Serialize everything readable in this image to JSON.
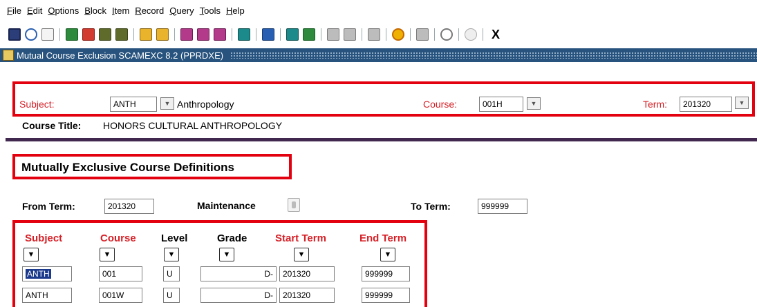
{
  "menu": [
    "File",
    "Edit",
    "Options",
    "Block",
    "Item",
    "Record",
    "Query",
    "Tools",
    "Help"
  ],
  "toolbar": {
    "exit_label": "X"
  },
  "window": {
    "title": "Mutual Course Exclusion  SCAMEXC  8.2  (PPRDXE)"
  },
  "key_block": {
    "subject_label": "Subject:",
    "subject_value": "ANTH",
    "subject_desc": "Anthropology",
    "course_label": "Course:",
    "course_value": "001H",
    "term_label": "Term:",
    "term_value": "201320",
    "course_title_label": "Course Title:",
    "course_title_value": "HONORS CULTURAL ANTHROPOLOGY"
  },
  "section": {
    "heading": "Mutually Exclusive Course Definitions",
    "from_term_label": "From Term:",
    "from_term_value": "201320",
    "maintenance_label": "Maintenance",
    "to_term_label": "To Term:",
    "to_term_value": "999999"
  },
  "grid": {
    "headers": [
      "Subject",
      "Course",
      "Level",
      "Grade",
      "Start Term",
      "End Term"
    ],
    "rows": [
      {
        "subject": "ANTH",
        "course": "001",
        "level": "U",
        "grade": "D-",
        "start": "201320",
        "end": "999999"
      },
      {
        "subject": "ANTH",
        "course": "001W",
        "level": "U",
        "grade": "D-",
        "start": "201320",
        "end": "999999"
      }
    ]
  },
  "colors": {
    "highlight": "#e3000f",
    "label_red": "#d61f26",
    "titlebar": "#27537e",
    "divider": "#41284f"
  }
}
